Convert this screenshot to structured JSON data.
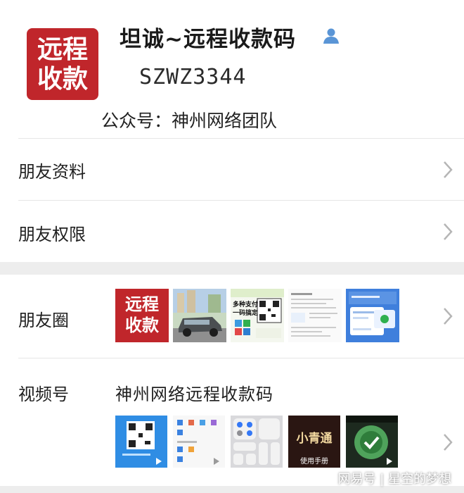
{
  "profile": {
    "avatar_line1": "远程",
    "avatar_line2": "收款",
    "name": "坦诚~远程收款码",
    "wechat_id": "SZWZ3344",
    "official_account": "公众号：神州网络团队"
  },
  "menu": {
    "friend_profile": "朋友资料",
    "friend_permissions": "朋友权限",
    "moments": "朋友圈",
    "channels": "视频号"
  },
  "moments_thumbs": {
    "t1_line1": "远程",
    "t1_line2": "收款",
    "t3_line1": "多种支付",
    "t3_line2": "一码搞定"
  },
  "channels": {
    "name": "神州网络远程收款码",
    "thumb4_title": "小青通",
    "thumb4_sub": "使用手册"
  },
  "watermark": "网易号 | 星空的梦想",
  "colors": {
    "brand_red": "#c0262b",
    "icon_blue": "#5a95d6",
    "divider": "#ededed"
  }
}
